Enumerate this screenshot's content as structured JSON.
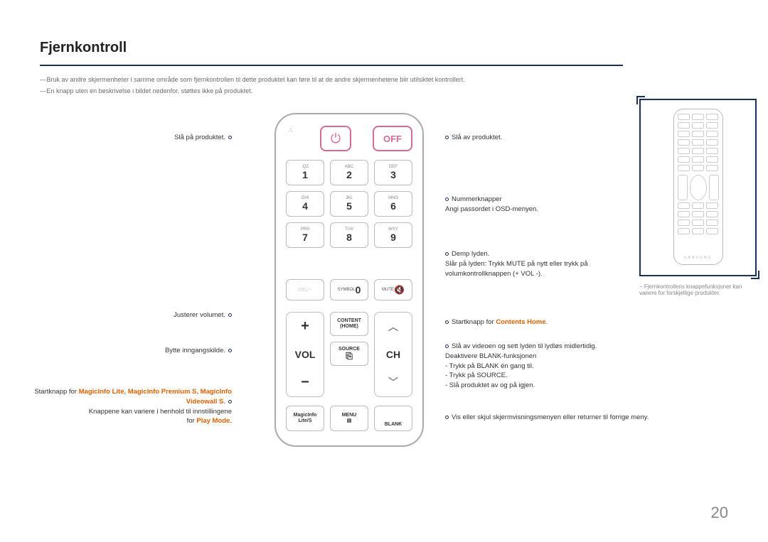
{
  "title": "Fjernkontroll",
  "notes": [
    "Bruk av andre skjermenheter i samme område som fjernkontrollen til dette produktet kan føre til at de andre skjermenhetene blir utilsiktet kontrollert.",
    "En knapp uten en beskrivelse i bildet nedenfor, støttes ikke på produktet."
  ],
  "remote": {
    "off_label": "OFF",
    "keys": [
      {
        "sub": ".QZ",
        "n": "1"
      },
      {
        "sub": "ABC",
        "n": "2"
      },
      {
        "sub": "DEF",
        "n": "3"
      },
      {
        "sub": "GHI",
        "n": "4"
      },
      {
        "sub": "JKL",
        "n": "5"
      },
      {
        "sub": "MNO",
        "n": "6"
      },
      {
        "sub": "PRS",
        "n": "7"
      },
      {
        "sub": "TUV",
        "n": "8"
      },
      {
        "sub": "WXY",
        "n": "9"
      }
    ],
    "row4": {
      "del": "DEL/−",
      "symbol": "SYMBOL",
      "zero": "0",
      "mute": "MUTE",
      "mute_icon": "✕"
    },
    "vol": {
      "plus": "+",
      "label": "VOL",
      "minus": "−"
    },
    "center": {
      "content": "CONTENT",
      "content2": "(HOME)",
      "source": "SOURCE",
      "source_icon": "↧"
    },
    "ch": {
      "up": "︿",
      "label": "CH",
      "down": "﹀"
    },
    "bottom": {
      "magicinfo": "MagicInfo",
      "magicinfo2": "Lite/S",
      "menu": "MENU",
      "menu_icon": "▥",
      "blank": "BLANK"
    }
  },
  "mini_brand": "SAMSUNG",
  "side_note": "Fjernkontrollens knappefunksjoner kan variere for forskjellige produkter.",
  "callouts": {
    "power_on": "Slå på produktet.",
    "vol_adj": "Justerer volumet.",
    "source_switch": "Bytte inngangskilde.",
    "magicinfo_pre": "Startknapp for ",
    "magicinfo_em": "MagicInfo Lite, MagicInfo Premium S, MagicInfo Videowall S",
    "magicinfo_post1": "Knappene kan variere i henhold til innstillingene",
    "magicinfo_post2_pre": "for ",
    "magicinfo_post2_em": "Play Mode",
    "power_off": "Slå av produktet.",
    "numkeys_l1": "Nummerknapper",
    "numkeys_l2": "Angi passordet i OSD-menyen.",
    "mute_l1": "Demp lyden.",
    "mute_l2": "Slår på lyden: Trykk MUTE på nytt eller trykk på volumkontrollknappen (+ VOL -).",
    "content_pre": "Startknapp for ",
    "content_em": "Contents Home",
    "blank_l1": "Slå av videoen og sett lyden til lydløs midlertidig.",
    "blank_l2": "Deaktivere BLANK-funksjonen",
    "blank_l3": "- Trykk på BLANK én gang til.",
    "blank_l4": "- Trykk på SOURCE.",
    "blank_l5": "- Slå produktet av og på igjen.",
    "menu_l1": "Vis eller skjul skjermvisningsmenyen eller returner til forrige meny."
  },
  "page_number": "20"
}
